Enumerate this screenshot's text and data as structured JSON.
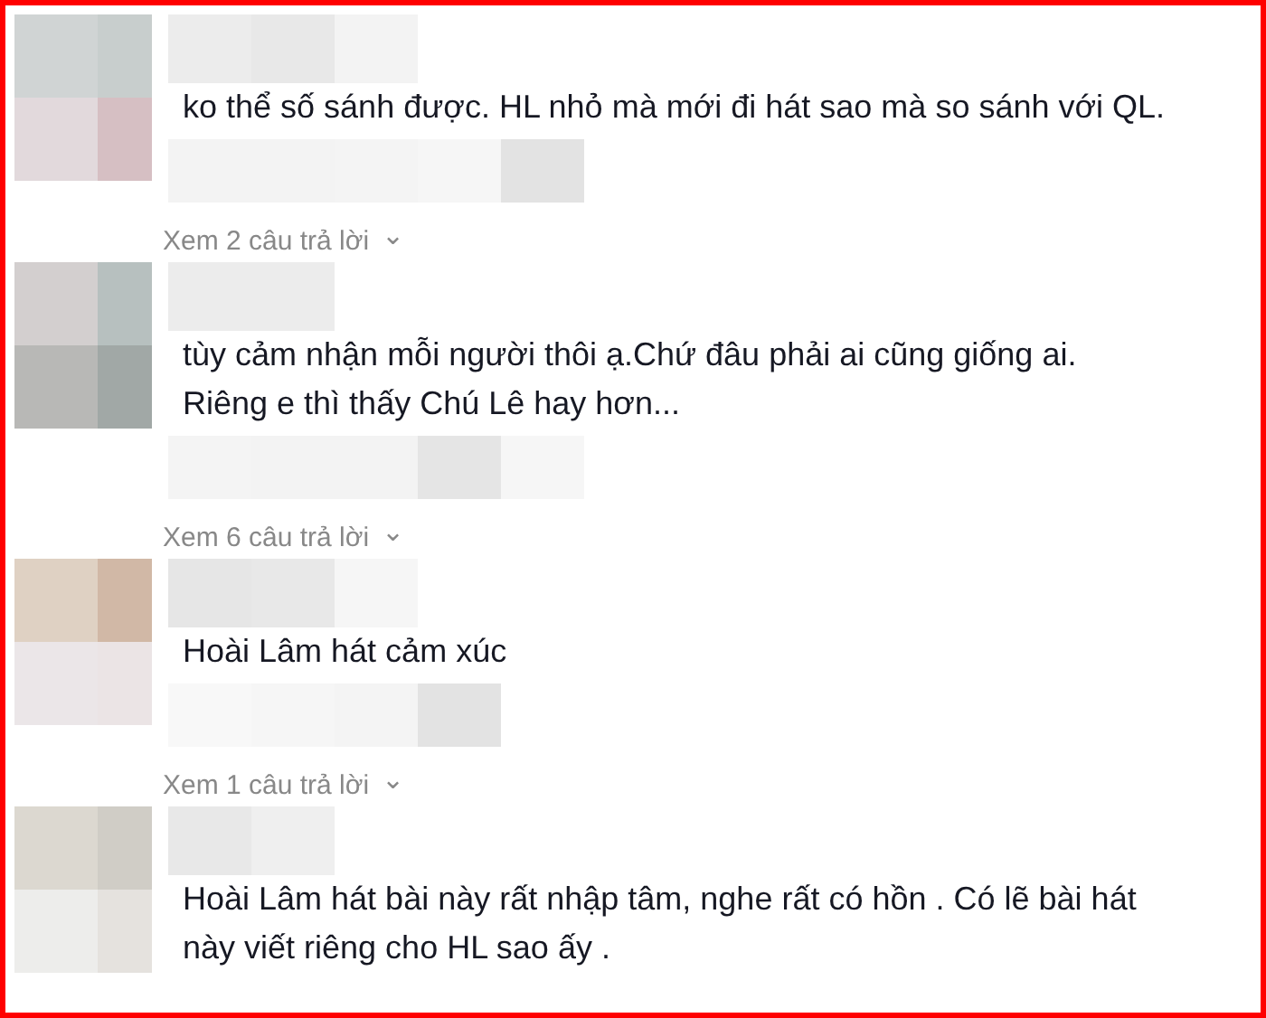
{
  "comments": [
    {
      "text": "ko thể số sánh được. HL nhỏ mà mới đi hát sao mà so sánh với QL.",
      "replies": {
        "label": "Xem 2 câu trả lời",
        "chevron": "⌄"
      }
    },
    {
      "text": "tùy cảm nhận mỗi người thôi ạ.Chứ đâu phải ai cũng giống ai.\nRiêng e thì thấy Chú Lê hay hơn...",
      "replies": {
        "label": "Xem 6 câu trả lời",
        "chevron": "⌄"
      }
    },
    {
      "text": "Hoài Lâm hát cảm xúc",
      "replies": {
        "label": "Xem 1 câu trả lời",
        "chevron": "⌄"
      }
    },
    {
      "text": "Hoài Lâm hát bài này rất nhập tâm, nghe rất có hồn . Có lẽ bài hát\nnày viết riêng cho HL sao ấy ."
    }
  ]
}
